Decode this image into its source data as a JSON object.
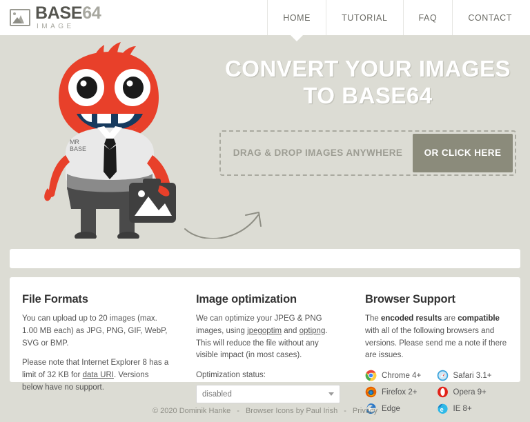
{
  "brand": {
    "title_main": "BASE",
    "title_num": "64",
    "subtitle": "IMAGE",
    "logo_icon": "picture-frame-icon"
  },
  "nav": {
    "items": [
      {
        "label": "HOME",
        "active": true
      },
      {
        "label": "TUTORIAL",
        "active": false
      },
      {
        "label": "FAQ",
        "active": false
      },
      {
        "label": "CONTACT",
        "active": false
      }
    ]
  },
  "hero": {
    "title_line1": "CONVERT YOUR IMAGES",
    "title_line2": "TO BASE64",
    "dropzone_label": "DRAG & DROP IMAGES ANYWHERE",
    "dropzone_button": "OR CLICK HERE",
    "mascot_tag_line1": "MR",
    "mascot_tag_line2": "BASE"
  },
  "info": {
    "file_formats": {
      "heading": "File Formats",
      "p1": "You can upload up to 20 images (max. 1.00 MB each) as JPG, PNG, GIF, WebP, SVG or BMP.",
      "p2_before": "Please note that Internet Explorer 8 has a limit of 32 KB for ",
      "p2_link": "data URI",
      "p2_after": ". Versions below have no support."
    },
    "optimization": {
      "heading": "Image optimization",
      "p1_before": "We can optimize your JPEG & PNG images, using ",
      "link1": "jpegoptim",
      "p1_mid": " and ",
      "link2": "optipng",
      "p1_after": ". This will reduce the file without any visible impact (in most cases).",
      "status_label": "Optimization status:",
      "status_value": "disabled"
    },
    "browser_support": {
      "heading": "Browser Support",
      "p1_a": "The ",
      "p1_b": "encoded results",
      "p1_c": " are ",
      "p1_d": "compatible",
      "p1_e": " with all of the following browsers and versions. Please send me a note if there are issues.",
      "browsers": [
        {
          "name": "Chrome 4+",
          "icon": "chrome-icon"
        },
        {
          "name": "Safari 3.1+",
          "icon": "safari-icon"
        },
        {
          "name": "Firefox 2+",
          "icon": "firefox-icon"
        },
        {
          "name": "Opera 9+",
          "icon": "opera-icon"
        },
        {
          "name": "Edge",
          "icon": "edge-icon"
        },
        {
          "name": "IE 8+",
          "icon": "ie-icon"
        }
      ]
    }
  },
  "footer": {
    "copyright": "© 2020 Dominik Hanke",
    "sep1": "-",
    "credit": "Browser Icons by Paul Irish",
    "sep2": "-",
    "privacy": "Privacy"
  },
  "colors": {
    "page_bg": "#dcdcd4",
    "button": "#8b8b7b",
    "mascot": "#e8402a",
    "text_dark": "#333333"
  }
}
